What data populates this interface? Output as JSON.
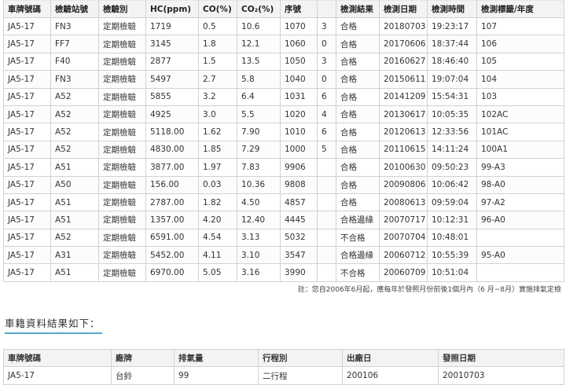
{
  "inspection": {
    "headers": [
      "車牌號碼",
      "檢驗站號",
      "檢驗別",
      "HC(ppm)",
      "CO(%)",
      "CO₂(%)",
      "序號",
      "",
      "檢測結果",
      "檢測日期",
      "檢測時間",
      "檢測標籤/年度"
    ],
    "rows": [
      [
        "JA5-17",
        "FN3",
        "定期檢驗",
        "1719",
        "0.5",
        "10.6",
        "1070",
        "3",
        "合格",
        "20180703",
        "19:23:17",
        "107"
      ],
      [
        "JA5-17",
        "FF7",
        "定期檢驗",
        "3145",
        "1.8",
        "12.1",
        "1060",
        "0",
        "合格",
        "20170606",
        "18:37:44",
        "106"
      ],
      [
        "JA5-17",
        "F40",
        "定期檢驗",
        "2877",
        "1.5",
        "13.5",
        "1050",
        "3",
        "合格",
        "20160627",
        "18:46:40",
        "105"
      ],
      [
        "JA5-17",
        "FN3",
        "定期檢驗",
        "5497",
        "2.7",
        "5.8",
        "1040",
        "0",
        "合格",
        "20150611",
        "19:07:04",
        "104"
      ],
      [
        "JA5-17",
        "A52",
        "定期檢驗",
        "5855",
        "3.2",
        "6.4",
        "1031",
        "6",
        "合格",
        "20141209",
        "15:54:31",
        "103"
      ],
      [
        "JA5-17",
        "A52",
        "定期檢驗",
        "4925",
        "3.0",
        "5.5",
        "1020",
        "4",
        "合格",
        "20130617",
        "10:05:35",
        "102AC"
      ],
      [
        "JA5-17",
        "A52",
        "定期檢驗",
        "5118.00",
        "1.62",
        "7.90",
        "1010",
        "6",
        "合格",
        "20120613",
        "12:33:56",
        "101AC"
      ],
      [
        "JA5-17",
        "A52",
        "定期檢驗",
        "4830.00",
        "1.85",
        "7.29",
        "1000",
        "5",
        "合格",
        "20110615",
        "14:11:24",
        "100A1"
      ],
      [
        "JA5-17",
        "A51",
        "定期檢驗",
        "3877.00",
        "1.97",
        "7.83",
        "9906",
        "",
        "合格",
        "20100630",
        "09:50:23",
        "99-A3"
      ],
      [
        "JA5-17",
        "A50",
        "定期檢驗",
        "156.00",
        "0.03",
        "10.36",
        "9808",
        "",
        "合格",
        "20090806",
        "10:06:42",
        "98-A0"
      ],
      [
        "JA5-17",
        "A51",
        "定期檢驗",
        "2787.00",
        "1.82",
        "4.50",
        "4857",
        "",
        "合格",
        "20080613",
        "09:59:04",
        "97-A2"
      ],
      [
        "JA5-17",
        "A51",
        "定期檢驗",
        "1357.00",
        "4.20",
        "12.40",
        "4445",
        "",
        "合格邊緣",
        "20070717",
        "10:12:31",
        "96-A0"
      ],
      [
        "JA5-17",
        "A52",
        "定期檢驗",
        "6591.00",
        "4.54",
        "3.13",
        "5032",
        "",
        "不合格",
        "20070704",
        "10:48:01",
        ""
      ],
      [
        "JA5-17",
        "A31",
        "定期檢驗",
        "5452.00",
        "4.11",
        "3.10",
        "3547",
        "",
        "合格邊緣",
        "20060712",
        "10:55:39",
        "95-A0"
      ],
      [
        "JA5-17",
        "A51",
        "定期檢驗",
        "6970.00",
        "5.05",
        "3.16",
        "3990",
        "",
        "不合格",
        "20060709",
        "10:51:04",
        ""
      ]
    ]
  },
  "note": "註：您自2006年6月起，應每年於發照月份前後1個月內（6 月~8月）實施排氣定檢",
  "vehicle_section_title": "車籍資料結果如下：",
  "vehicle": {
    "headers": [
      "車牌號碼",
      "廠牌",
      "排氣量",
      "行程別",
      "出廠日",
      "發照日期"
    ],
    "rows": [
      [
        "JA5-17",
        "台鈴",
        "99",
        "二行程",
        "200106",
        "20010703"
      ]
    ]
  }
}
